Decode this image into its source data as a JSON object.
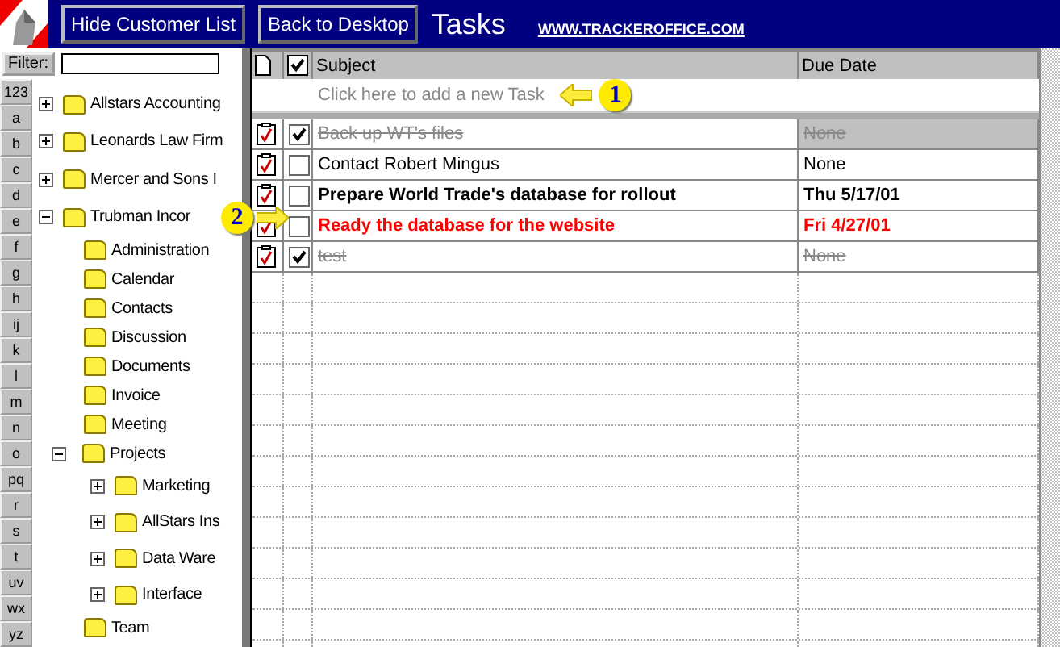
{
  "header": {
    "buttons": [
      "Hide Customer List",
      "Back to Desktop"
    ],
    "title": "Tasks",
    "url": "WWW.TRACKEROFFICE.COM"
  },
  "filter": {
    "label": "Filter:"
  },
  "letters": [
    "123",
    "a",
    "b",
    "c",
    "d",
    "e",
    "f",
    "g",
    "h",
    "ij",
    "k",
    "l",
    "m",
    "n",
    "o",
    "pq",
    "r",
    "s",
    "t",
    "uv",
    "wx",
    "yz"
  ],
  "tree": [
    {
      "label": "Allstars Accounting",
      "expanded": false
    },
    {
      "label": "Leonards Law Firm",
      "expanded": false
    },
    {
      "label": "Mercer and Sons I",
      "expanded": false
    },
    {
      "label": "Trubman Incor",
      "expanded": true,
      "children": [
        {
          "label": "Administration"
        },
        {
          "label": "Calendar"
        },
        {
          "label": "Contacts"
        },
        {
          "label": "Discussion"
        },
        {
          "label": "Documents"
        },
        {
          "label": "Invoice"
        },
        {
          "label": "Meeting"
        },
        {
          "label": "Projects",
          "expanded": true,
          "children": [
            {
              "label": "Marketing",
              "expanded": false
            },
            {
              "label": "AllStars Ins",
              "expanded": false
            },
            {
              "label": "Data Ware",
              "expanded": false
            },
            {
              "label": "Interface",
              "expanded": false
            }
          ]
        },
        {
          "label": "Team"
        }
      ]
    }
  ],
  "table": {
    "columns": [
      "Subject",
      "Due Date"
    ],
    "new_task_prompt": "Click here to add a new Task",
    "rows": [
      {
        "subject": "Back up WT's files",
        "due": "None",
        "checked": true,
        "kind": "done",
        "selected": true
      },
      {
        "subject": "Contact Robert Mingus",
        "due": "None",
        "checked": false,
        "kind": "normal",
        "selected": false
      },
      {
        "subject": "Prepare World Trade's database for rollout",
        "due": "Thu 5/17/01",
        "checked": false,
        "kind": "bold",
        "selected": false
      },
      {
        "subject": "Ready the database for the website",
        "due": "Fri 4/27/01",
        "checked": false,
        "kind": "overdue",
        "selected": false
      },
      {
        "subject": "test",
        "due": "None",
        "checked": true,
        "kind": "done",
        "selected": false
      }
    ]
  },
  "callouts": [
    "1",
    "2"
  ]
}
